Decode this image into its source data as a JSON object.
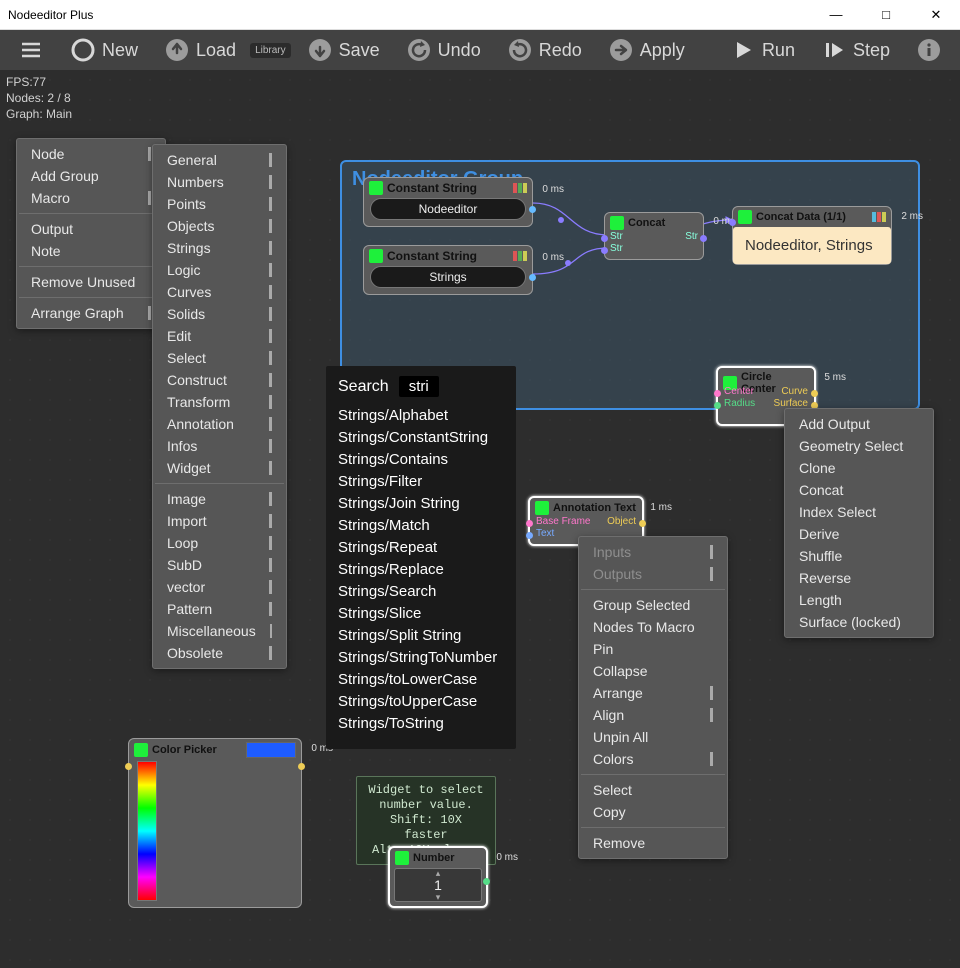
{
  "window": {
    "title": "Nodeeditor Plus"
  },
  "toolbar": {
    "new": "New",
    "load": "Load",
    "library_chip": "Library",
    "save": "Save",
    "undo": "Undo",
    "redo": "Redo",
    "apply": "Apply",
    "run": "Run",
    "step": "Step"
  },
  "stats": {
    "fps": "FPS:77",
    "nodes": "Nodes: 2 / 8",
    "graph": "Graph: Main"
  },
  "menu_main": {
    "items": [
      "Node",
      "Add Group",
      "Macro"
    ],
    "items2": [
      "Output",
      "Note"
    ],
    "items3": [
      "Remove Unused"
    ],
    "items4": [
      "Arrange Graph"
    ]
  },
  "menu_categories": {
    "items": [
      "General",
      "Numbers",
      "Points",
      "Objects",
      "Strings",
      "Logic",
      "Curves",
      "Solids",
      "Edit",
      "Select",
      "Construct",
      "Transform",
      "Annotation",
      "Infos",
      "Widget"
    ],
    "items2": [
      "Image",
      "Import",
      "Loop",
      "SubD",
      "vector",
      "Pattern",
      "Miscellaneous",
      "Obsolete"
    ]
  },
  "group": {
    "title": "Nodeeditor Group"
  },
  "nodes": {
    "const1": {
      "title": "Constant String",
      "value": "Nodeeditor",
      "time": "0 ms"
    },
    "const2": {
      "title": "Constant String",
      "value": "Strings",
      "time": "0 ms"
    },
    "concat": {
      "title": "Concat",
      "time": "0 ms",
      "port_in1": "Str",
      "port_in2": "Str",
      "port_out": "Str"
    },
    "concatdata": {
      "title": "Concat Data (1/1)",
      "value": "Nodeeditor, Strings",
      "time": "2 ms"
    },
    "circle": {
      "title": "Circle Center",
      "time": "5 ms",
      "in1": "Center",
      "in2": "Radius",
      "out1": "Curve",
      "out2": "Surface"
    },
    "annot": {
      "title": "Annotation Text",
      "time": "1 ms",
      "in1": "Base Frame",
      "in2": "Text",
      "out1": "Object"
    },
    "colorpicker": {
      "title": "Color Picker",
      "time": "0 ms"
    },
    "number": {
      "title": "Number",
      "time": "0 ms",
      "value": "1"
    }
  },
  "search": {
    "label": "Search",
    "query": "stri",
    "rows": [
      "Strings/Alphabet",
      "Strings/ConstantString",
      "Strings/Contains",
      "Strings/Filter",
      "Strings/Join String",
      "Strings/Match",
      "Strings/Repeat",
      "Strings/Replace",
      "Strings/Search",
      "Strings/Slice",
      "Strings/Split String",
      "Strings/StringToNumber",
      "Strings/toLowerCase",
      "Strings/toUpperCase",
      "Strings/ToString"
    ]
  },
  "menu_circle": {
    "items": [
      "Add Output",
      "Geometry Select",
      "Clone",
      "Concat",
      "Index Select",
      "Derive",
      "Shuffle",
      "Reverse",
      "Length",
      "Surface (locked)"
    ]
  },
  "menu_annot": {
    "head": [
      "Inputs",
      "Outputs"
    ],
    "items": [
      "Group Selected",
      "Nodes To Macro",
      "Pin",
      "Collapse",
      "Arrange",
      "Align",
      "Unpin All",
      "Colors"
    ],
    "items2": [
      "Select",
      "Copy"
    ],
    "items3": [
      "Remove"
    ]
  },
  "tooltip": {
    "l1": "Widget to select",
    "l2": "number value.",
    "l3": "Shift: 10X faster",
    "l4": "Alt: 10X slower"
  }
}
